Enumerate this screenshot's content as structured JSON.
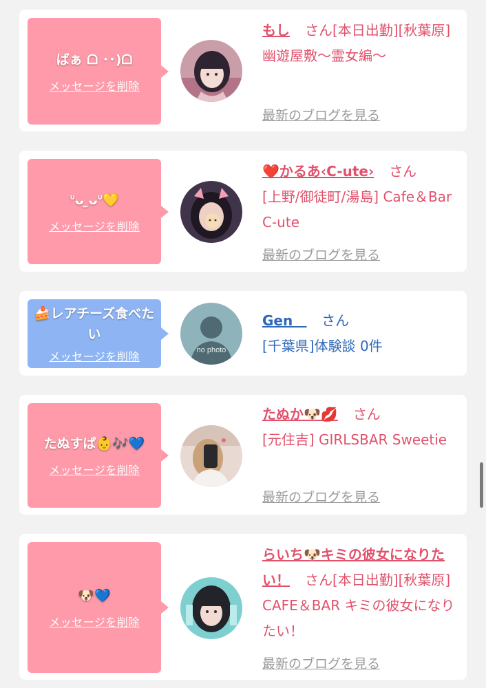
{
  "delete_label": "メッセージを削除",
  "blog_label": "最新のブログを見る",
  "colors": {
    "pink_bubble": "#fe9aa9",
    "blue_bubble": "#8fb4f4",
    "pink_text": "#e1516b",
    "blue_text": "#2e68b8",
    "gray_link": "#9a9a9a"
  },
  "messages": [
    {
      "bubble_text": "ばぁ ᗝ ･･)ᗝ",
      "name": "もし",
      "san": "さん",
      "info_text": "[本日出勤][秋葉原] 幽遊屋敷〜霊女編〜",
      "avatar_icon": "girl-photo-avatar",
      "has_blog_link": true
    },
    {
      "bubble_text": "ᐡᴗ ̫ᴗᐡ💛",
      "name": "❤️かるあ‹C-ute›",
      "san": "さん",
      "info_text": "[上野/御徒町/湯島] Cafe＆Bar C-ute",
      "avatar_icon": "girl-photo-avatar",
      "has_blog_link": true
    },
    {
      "bubble_text": "🍰レアチーズ食べたい",
      "name": "Gen＿",
      "san": "さん",
      "info_text": "[千葉県]体験談 0件",
      "avatar_icon": "no-photo-avatar",
      "avatar_caption": "no photo",
      "has_blog_link": false
    },
    {
      "bubble_text": "たぬすぱ👶🎶💙",
      "name": "たぬか🐶💋",
      "san": "さん",
      "info_text": "[元住吉] GIRLSBAR Sweetie",
      "avatar_icon": "girl-photo-avatar",
      "has_blog_link": true
    },
    {
      "bubble_text": "🐶💙",
      "name": "らいち🐶キミの彼女になりたい！",
      "san": "さん",
      "info_text": "[本日出勤][秋葉原] CAFE＆BAR キミの彼女になりたい！",
      "avatar_icon": "girl-photo-avatar",
      "has_blog_link": true
    }
  ]
}
